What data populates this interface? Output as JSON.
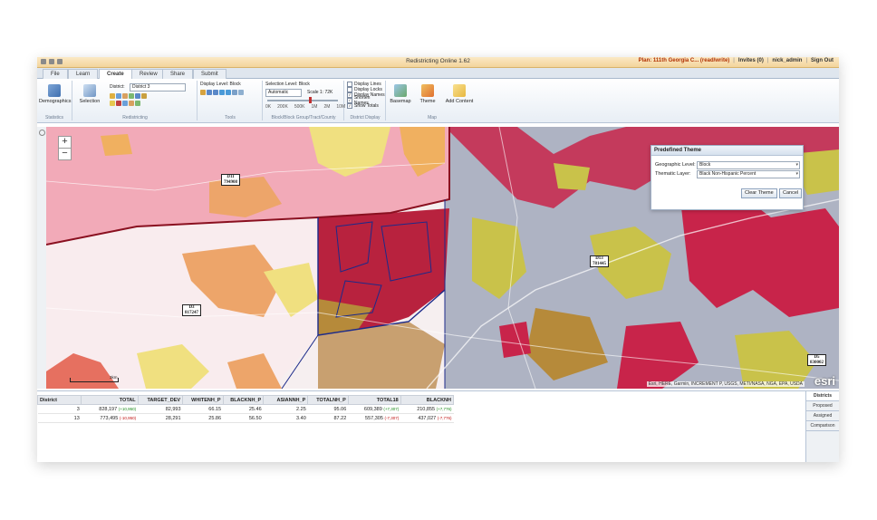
{
  "app": {
    "title": "Redistricting Online 1.62",
    "plan": "Plan: 111th Georgia C... (read/write)",
    "invites": "Invites (0)",
    "user": "nick_admin",
    "sign_out": "Sign Out"
  },
  "tabs": [
    "File",
    "Learn",
    "Create",
    "Review",
    "Share",
    "Submit"
  ],
  "active_tab": "Create",
  "ribbon": {
    "demographics": "Demographics",
    "selection": "Selection",
    "district_label": "District:",
    "district_value": "District 3",
    "display_level": "Display Level: Block",
    "selection_level": "Selection Level: Block",
    "automatic": "Automatic",
    "scale": "Scale 1: 72K",
    "scale_ticks": [
      "0K",
      "200K",
      "500K",
      "1M",
      "2M",
      "10M"
    ],
    "checkboxes": [
      {
        "label": "Display Lines",
        "checked": false
      },
      {
        "label": "Display Locks",
        "checked": false
      },
      {
        "label": "Display Names",
        "checked": true
      },
      {
        "label": "Shorten Names",
        "checked": true
      },
      {
        "label": "Show Totals",
        "checked": true
      }
    ],
    "basemap": "Basemap",
    "theme": "Theme",
    "add_content": "Add Content",
    "groups": [
      "Statistics",
      "Redistricting",
      "Tools",
      "Block/Block Group/Tract/County",
      "District Display",
      "Map"
    ]
  },
  "map": {
    "district_labels": [
      {
        "name": "D11",
        "value": "794908"
      },
      {
        "name": "D13",
        "value": "781445"
      },
      {
        "name": "D3",
        "value": "817247"
      },
      {
        "name": "D5",
        "value": "830002"
      }
    ],
    "attribution": "Esri, HERE, Garmin, INCREMENT P, USGS, METI/NASA, NGA, EPA, USDA",
    "esri": "esri",
    "scale_label": "3km",
    "zoom_in": "+",
    "zoom_out": "−"
  },
  "theme_panel": {
    "title": "Predefined Theme",
    "geo_label": "Geographic Level:",
    "geo_value": "Block",
    "layer_label": "Thematic Layer:",
    "layer_value": "Black Non-Hispanic Percent",
    "clear_button": "Clear Theme",
    "cancel_button": "Cancel"
  },
  "table": {
    "columns": [
      "District",
      "TOTAL",
      "TARGET_DEV",
      "WHITENH_P",
      "BLACKNH_P",
      "ASIANNH_P",
      "TOTALNH_P",
      "TOTAL18",
      "BLACKNH"
    ],
    "rows": [
      {
        "district": "3",
        "total": "828,197",
        "total_delta": "(+10,950)",
        "target_dev": "82,993",
        "whitenh_p": "66.15",
        "blacknh_p": "25.46",
        "asiannh_p": "2.25",
        "totalnh_p": "95.06",
        "total18": "609,389",
        "total18_delta": "(+7,307)",
        "blacknh": "210,855",
        "blacknh_delta": "(+7,776)"
      },
      {
        "district": "13",
        "total": "773,495",
        "total_delta": "(-10,950)",
        "target_dev": "28,291",
        "whitenh_p": "25.86",
        "blacknh_p": "56.50",
        "asiannh_p": "3.40",
        "totalnh_p": "87.22",
        "total18": "557,305",
        "total18_delta": "(-7,307)",
        "blacknh": "437,027",
        "blacknh_delta": "(-7,776)"
      }
    ]
  },
  "side_tabs": [
    "Districts",
    "Proposed",
    "Assigned",
    "Comparison"
  ]
}
